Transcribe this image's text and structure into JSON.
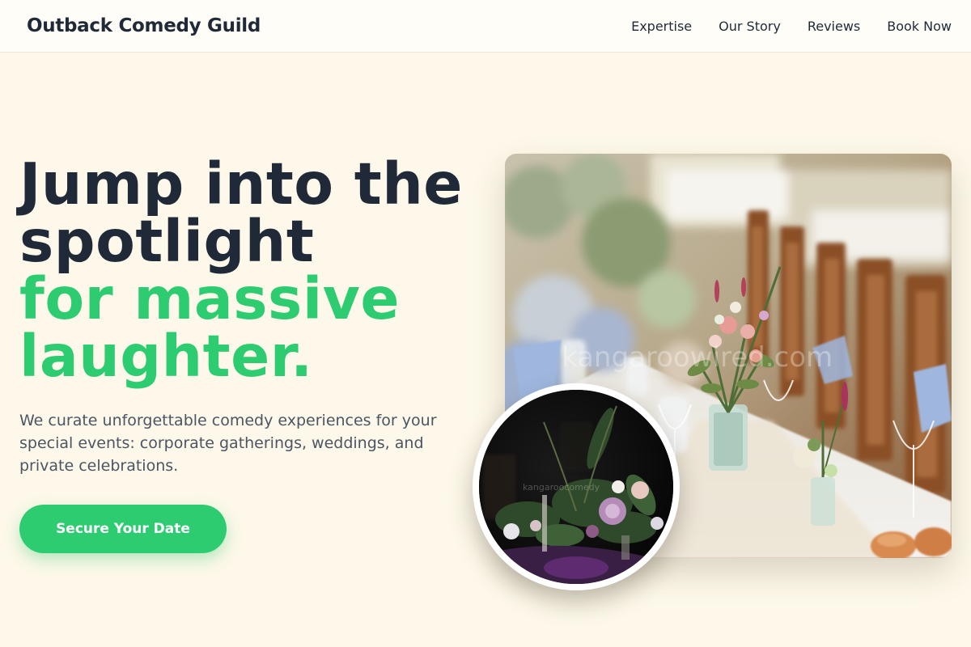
{
  "header": {
    "brand": "Outback Comedy Guild",
    "nav": [
      {
        "label": "Expertise"
      },
      {
        "label": "Our Story"
      },
      {
        "label": "Reviews"
      },
      {
        "label": "Book Now"
      }
    ]
  },
  "hero": {
    "headline_line1": "Jump into the",
    "headline_line2": "spotlight",
    "headline_accent1": "for massive",
    "headline_accent2": "laughter.",
    "description": "We curate unforgettable comedy experiences for your special events: corporate gatherings, weddings, and private celebrations.",
    "cta_label": "Secure Your Date"
  },
  "images": {
    "main_watermark": "kangaroowired.com",
    "round_watermark": "kangaroocomedy"
  },
  "colors": {
    "background": "#fdf8e9",
    "accent": "#2ecc71",
    "text": "#1f2937"
  }
}
